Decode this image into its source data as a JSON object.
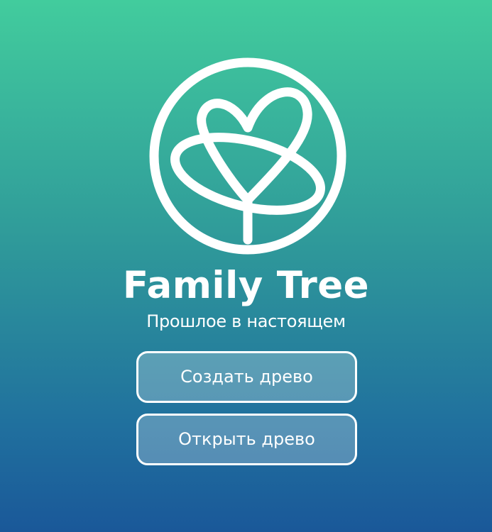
{
  "app": {
    "title": "Family Tree",
    "subtitle": "Прошлое в настоящем"
  },
  "logo": {
    "icon": "family-tree-logo-icon"
  },
  "actions": {
    "create_label": "Создать древо",
    "open_label": "Открыть древо"
  },
  "colors": {
    "gradient_top": "#42cc9d",
    "gradient_bottom": "#1a5899",
    "foreground": "#ffffff"
  }
}
